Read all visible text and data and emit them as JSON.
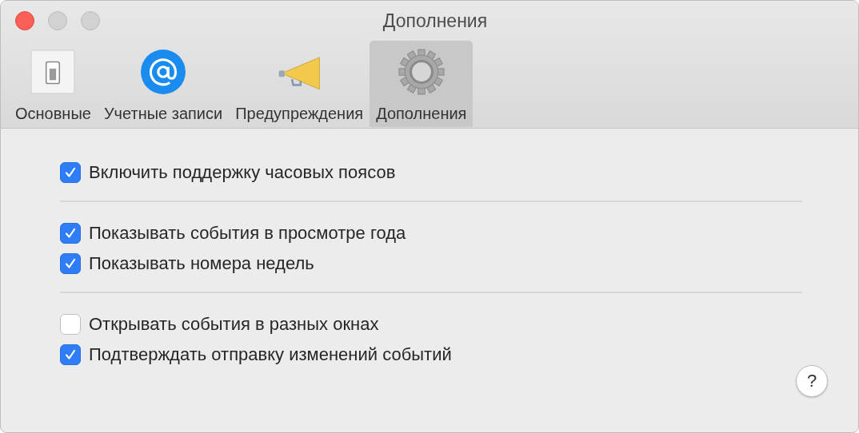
{
  "window": {
    "title": "Дополнения"
  },
  "tabs": [
    {
      "label": "Основные",
      "kind": "switch",
      "selected": false
    },
    {
      "label": "Учетные записи",
      "kind": "at",
      "selected": false
    },
    {
      "label": "Предупреждения",
      "kind": "megaphone",
      "selected": false
    },
    {
      "label": "Дополнения",
      "kind": "gear",
      "selected": true
    }
  ],
  "groups": [
    [
      {
        "label": "Включить поддержку часовых поясов",
        "checked": true
      }
    ],
    [
      {
        "label": "Показывать события в просмотре года",
        "checked": true
      },
      {
        "label": "Показывать номера недель",
        "checked": true
      }
    ],
    [
      {
        "label": "Открывать события в разных окнах",
        "checked": false
      },
      {
        "label": "Подтверждать отправку изменений событий",
        "checked": true
      }
    ]
  ],
  "help_button": {
    "label": "?"
  }
}
